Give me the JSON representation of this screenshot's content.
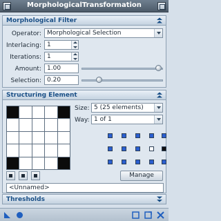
{
  "window": {
    "title": "MorphologicalTransformation"
  },
  "filter_section": {
    "title": "Morphological Filter",
    "operator_label": "Operator:",
    "operator_value": "Morphological Selection",
    "interlacing_label": "Interlacing:",
    "interlacing_value": "1",
    "iterations_label": "Iterations:",
    "iterations_value": "1",
    "amount_label": "Amount:",
    "amount_value": "1.00",
    "amount_level": 1.0,
    "selection_label": "Selection:",
    "selection_value": "0.20",
    "selection_level": 0.2
  },
  "structuring_section": {
    "title": "Structuring Element",
    "size_label": "Size:",
    "size_value": "5  (25 elements)",
    "way_label": "Way:",
    "way_value": "1 of 1",
    "grid": [
      [
        "off",
        "on",
        "on",
        "on",
        "off"
      ],
      [
        "on",
        "on",
        "on",
        "on",
        "on"
      ],
      [
        "on",
        "on",
        "on",
        "on",
        "on"
      ],
      [
        "on",
        "on",
        "on",
        "on",
        "on"
      ],
      [
        "off",
        "on",
        "on",
        "on",
        "off"
      ]
    ],
    "manage_label": "Manage",
    "name_value": "<Unnamed>"
  },
  "thresholds_section": {
    "title": "Thresholds"
  },
  "colors": {
    "accent": "#1a4f86",
    "element_on": "#ffffff",
    "element_off": "#0b0b0b"
  }
}
